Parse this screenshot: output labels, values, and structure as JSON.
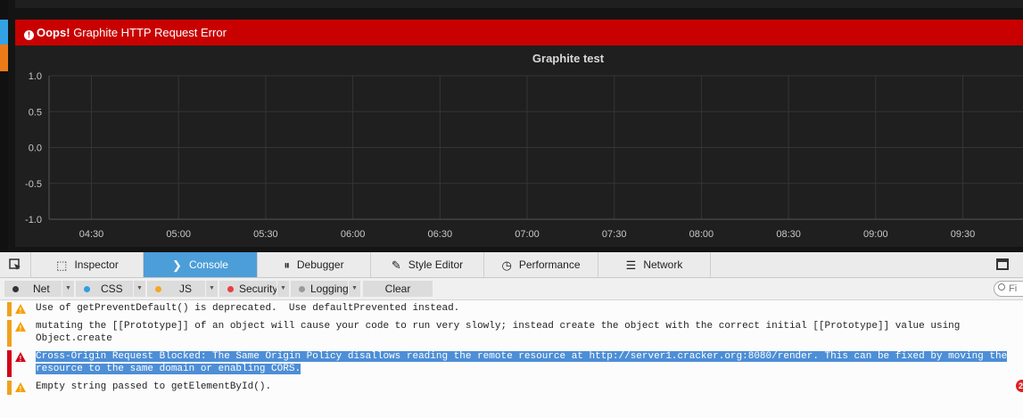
{
  "grafana": {
    "error_banner": {
      "strong": "Oops!",
      "message": "Graphite HTTP Request Error"
    },
    "panel": {
      "title": "Graphite test"
    }
  },
  "chart_data": {
    "type": "line",
    "title": "Graphite test",
    "xlabel": "",
    "ylabel": "",
    "x_ticks": [
      "04:30",
      "05:00",
      "05:30",
      "06:00",
      "06:30",
      "07:00",
      "07:30",
      "08:00",
      "08:30",
      "09:00",
      "09:30"
    ],
    "y_ticks": [
      "1.0",
      "0.5",
      "0.0",
      "-0.5",
      "-1.0"
    ],
    "ylim": [
      -1.0,
      1.0
    ],
    "grid": true,
    "series": []
  },
  "devtools": {
    "tabs": [
      {
        "id": "inspector",
        "label": "Inspector",
        "icon": "inspector-icon",
        "glyph": "⬚",
        "selected": false
      },
      {
        "id": "console",
        "label": "Console",
        "icon": "console-icon",
        "glyph": "❯",
        "selected": true
      },
      {
        "id": "debugger",
        "label": "Debugger",
        "icon": "debugger-icon",
        "glyph": "⏸",
        "selected": false
      },
      {
        "id": "style-editor",
        "label": "Style Editor",
        "icon": "style-editor-icon",
        "glyph": "✎",
        "selected": false
      },
      {
        "id": "performance",
        "label": "Performance",
        "icon": "performance-icon",
        "glyph": "◷",
        "selected": false
      },
      {
        "id": "network",
        "label": "Network",
        "icon": "network-icon",
        "glyph": "☰",
        "selected": false
      }
    ],
    "filters": [
      {
        "id": "net",
        "label": "Net",
        "color": "#333333"
      },
      {
        "id": "css",
        "label": "CSS",
        "color": "#2e9fe0"
      },
      {
        "id": "js",
        "label": "JS",
        "color": "#f5a623"
      },
      {
        "id": "security",
        "label": "Security",
        "color": "#e84040"
      },
      {
        "id": "logging",
        "label": "Logging",
        "color": "#9a9a9a"
      }
    ],
    "clear_label": "Clear",
    "filter_placeholder": "Fi",
    "messages": [
      {
        "level": "warning",
        "text": "Use of getPreventDefault() is deprecated.  Use defaultPrevented instead."
      },
      {
        "level": "warning",
        "text": "mutating the [[Prototype]] of an object will cause your code to run very slowly; instead create the object with the correct initial [[Prototype]] value using\nObject.create"
      },
      {
        "level": "error",
        "text": "Cross-Origin Request Blocked: The Same Origin Policy disallows reading the remote resource at http://server1.cracker.org:8080/render. This can be fixed by moving the\nresource to the same domain or enabling CORS.",
        "selected": true
      },
      {
        "level": "warning",
        "text": "Empty string passed to getElementById()."
      }
    ],
    "error_count": "2"
  }
}
